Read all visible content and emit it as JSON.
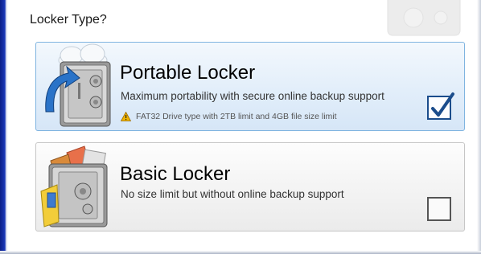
{
  "header": {
    "title": "Locker Type?"
  },
  "options": [
    {
      "title": "Portable Locker",
      "description": "Maximum portability with secure online backup support",
      "note": "FAT32 Drive type with 2TB limit and 4GB file size limit",
      "checked": true
    },
    {
      "title": "Basic Locker",
      "description": "No size limit but without online backup support",
      "checked": false
    }
  ],
  "colors": {
    "selected_border": "#7fb4e0",
    "selected_bg": "#e2eefa",
    "checkmark": "#1b4d8c",
    "warning": "#f0b400"
  },
  "icons": [
    "safe-cloud-icon",
    "warning-icon",
    "safe-documents-icon",
    "checkmark-icon"
  ]
}
